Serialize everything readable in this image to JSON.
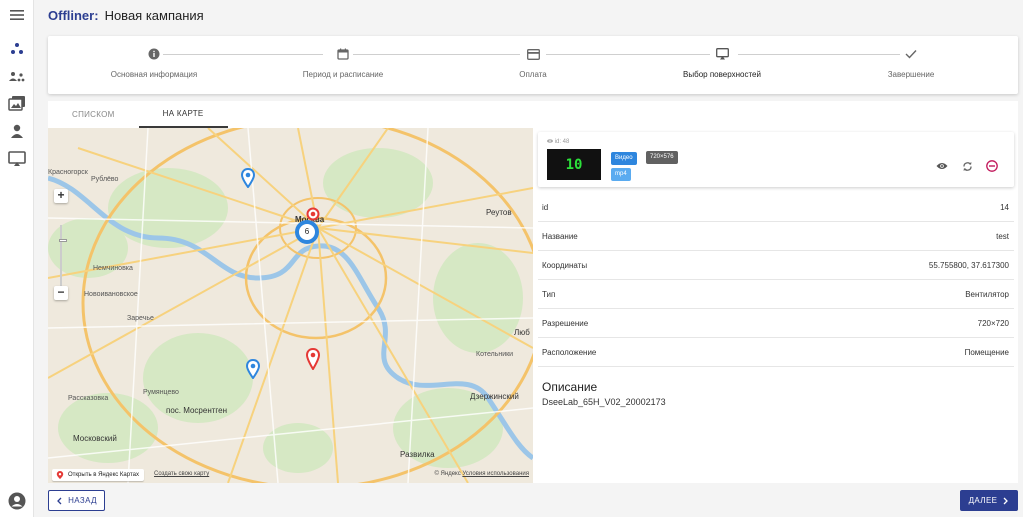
{
  "app": {
    "brand": "Offliner:",
    "title": "Новая кампания"
  },
  "rail": {
    "icons": [
      "menu-icon",
      "dots-icon",
      "users-icon",
      "gallery-icon",
      "person-icon",
      "monitor-icon",
      "account-icon"
    ]
  },
  "stepper": {
    "steps": [
      {
        "label": "Основная информация",
        "icon": "info-icon"
      },
      {
        "label": "Период и расписание",
        "icon": "calendar-icon"
      },
      {
        "label": "Оплата",
        "icon": "card-icon"
      },
      {
        "label": "Выбор поверхностей",
        "icon": "cast-icon",
        "active": true
      },
      {
        "label": "Завершение",
        "icon": "check-icon"
      }
    ]
  },
  "tabs": {
    "list": "СПИСКОМ",
    "map": "НА КАРТЕ",
    "active": "map"
  },
  "map": {
    "cluster_count": "6",
    "labels": {
      "rublevo": "Рублёво",
      "krasnogorsk": "Красногорск",
      "moscow": "Москва",
      "reutov": "Реутов",
      "nemchinovka": "Немчиновка",
      "novoivankovskoe": "Новоивановское",
      "zarechye": "Заречье",
      "lyub": "Люб",
      "kotelniki": "Котельники",
      "rumyantsevo": "Румянцево",
      "mosrentgen": "пос. Мосрентген",
      "dzerzhinsky": "Дзержинский",
      "rasskazovka": "Рассказовка",
      "moskovsky": "Московский",
      "razvilka": "Развилка"
    },
    "open_yandex": "Открыть в Яндекс Картах",
    "create_map": "Создать свою карту",
    "copyright": "© Яндекс",
    "terms": "Условия использования"
  },
  "surface": {
    "id_label": "id: 48",
    "thumb_text": "10",
    "badge_video": "Видео",
    "badge_res": "720×576",
    "badge_format": "mp4",
    "colors": {
      "video": "#2e86de",
      "res": "#616161",
      "format": "#5aabf0",
      "remove": "#c2185b"
    }
  },
  "properties": [
    {
      "key": "id",
      "value": "14"
    },
    {
      "key": "Название",
      "value": "test"
    },
    {
      "key": "Координаты",
      "value": "55.755800, 37.617300"
    },
    {
      "key": "Тип",
      "value": "Вентилятор"
    },
    {
      "key": "Разрешение",
      "value": "720×720"
    },
    {
      "key": "Расположение",
      "value": "Помещение"
    }
  ],
  "description": {
    "title": "Описание",
    "text": "DseeLab_65H_V02_20002173"
  },
  "footer": {
    "back": "НАЗАД",
    "next": "ДАЛЕЕ"
  },
  "colors": {
    "primary": "#2c3e91",
    "pin_blue": "#2e86de",
    "pin_red": "#e53935"
  }
}
